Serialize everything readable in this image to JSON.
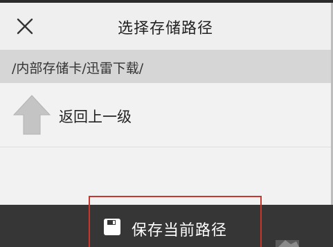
{
  "header": {
    "title": "选择存储路径",
    "close_icon": "close-icon"
  },
  "path_bar": {
    "current_path": "/内部存储卡/迅雷下载/"
  },
  "list": {
    "items": [
      {
        "label": "返回上一级",
        "icon": "arrow-up-icon"
      }
    ]
  },
  "footer": {
    "save_label": "保存当前路径",
    "save_icon": "save-icon"
  },
  "colors": {
    "background": "#f2f2f2",
    "path_bar": "#d6d6d6",
    "footer": "#363636",
    "highlight_box": "#c8372d",
    "up_arrow": "#c4c4c4"
  }
}
